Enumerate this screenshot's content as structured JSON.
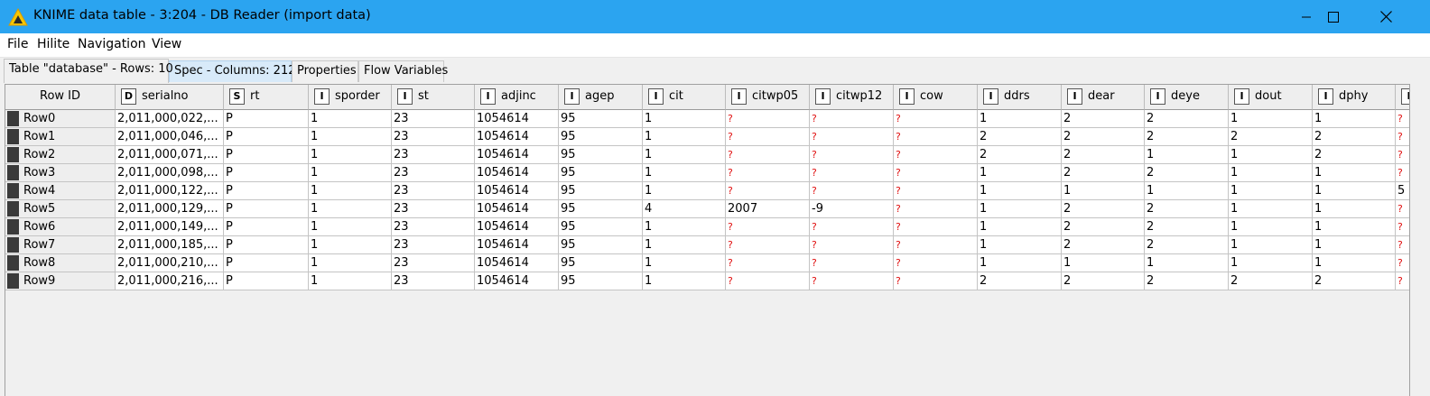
{
  "window": {
    "title": "KNIME data table - 3:204 - DB Reader (import data)",
    "accent_color": "#2ba4f0",
    "app_icon": "knime-triangle-icon",
    "controls": [
      "minimize-icon",
      "maximize-icon",
      "close-icon"
    ]
  },
  "menu": [
    "File",
    "Hilite",
    "Navigation",
    "View"
  ],
  "tabs": [
    "Table \"database\" - Rows: 10",
    "Spec - Columns: 212",
    "Properties",
    "Flow Variables"
  ],
  "table": {
    "rowid_header": "Row ID",
    "columns": [
      {
        "type": "D",
        "name": "serialno"
      },
      {
        "type": "S",
        "name": "rt"
      },
      {
        "type": "I",
        "name": "sporder"
      },
      {
        "type": "I",
        "name": "st"
      },
      {
        "type": "I",
        "name": "adjinc"
      },
      {
        "type": "I",
        "name": "agep"
      },
      {
        "type": "I",
        "name": "cit"
      },
      {
        "type": "I",
        "name": "citwp05"
      },
      {
        "type": "I",
        "name": "citwp12"
      },
      {
        "type": "I",
        "name": "cow"
      },
      {
        "type": "I",
        "name": "ddrs"
      },
      {
        "type": "I",
        "name": "dear"
      },
      {
        "type": "I",
        "name": "deye"
      },
      {
        "type": "I",
        "name": "dout"
      },
      {
        "type": "I",
        "name": "dphy"
      },
      {
        "type": "I",
        "name": ""
      }
    ],
    "missing_color": "#e01010",
    "rows": [
      {
        "id": "Row0",
        "cells": [
          "2,011,000,022,...",
          "P",
          "1",
          "23",
          "1054614",
          "95",
          "1",
          "?",
          "?",
          "?",
          "1",
          "2",
          "2",
          "1",
          "1",
          "?"
        ]
      },
      {
        "id": "Row1",
        "cells": [
          "2,011,000,046,...",
          "P",
          "1",
          "23",
          "1054614",
          "95",
          "1",
          "?",
          "?",
          "?",
          "2",
          "2",
          "2",
          "2",
          "2",
          "?"
        ]
      },
      {
        "id": "Row2",
        "cells": [
          "2,011,000,071,...",
          "P",
          "1",
          "23",
          "1054614",
          "95",
          "1",
          "?",
          "?",
          "?",
          "2",
          "2",
          "1",
          "1",
          "2",
          "?"
        ]
      },
      {
        "id": "Row3",
        "cells": [
          "2,011,000,098,...",
          "P",
          "1",
          "23",
          "1054614",
          "95",
          "1",
          "?",
          "?",
          "?",
          "1",
          "2",
          "2",
          "1",
          "1",
          "?"
        ]
      },
      {
        "id": "Row4",
        "cells": [
          "2,011,000,122,...",
          "P",
          "1",
          "23",
          "1054614",
          "95",
          "1",
          "?",
          "?",
          "?",
          "1",
          "1",
          "1",
          "1",
          "1",
          "5"
        ]
      },
      {
        "id": "Row5",
        "cells": [
          "2,011,000,129,...",
          "P",
          "1",
          "23",
          "1054614",
          "95",
          "4",
          "2007",
          "-9",
          "?",
          "1",
          "2",
          "2",
          "1",
          "1",
          "?"
        ]
      },
      {
        "id": "Row6",
        "cells": [
          "2,011,000,149,...",
          "P",
          "1",
          "23",
          "1054614",
          "95",
          "1",
          "?",
          "?",
          "?",
          "1",
          "2",
          "2",
          "1",
          "1",
          "?"
        ]
      },
      {
        "id": "Row7",
        "cells": [
          "2,011,000,185,...",
          "P",
          "1",
          "23",
          "1054614",
          "95",
          "1",
          "?",
          "?",
          "?",
          "1",
          "2",
          "2",
          "1",
          "1",
          "?"
        ]
      },
      {
        "id": "Row8",
        "cells": [
          "2,011,000,210,...",
          "P",
          "1",
          "23",
          "1054614",
          "95",
          "1",
          "?",
          "?",
          "?",
          "1",
          "1",
          "1",
          "1",
          "1",
          "?"
        ]
      },
      {
        "id": "Row9",
        "cells": [
          "2,011,000,216,...",
          "P",
          "1",
          "23",
          "1054614",
          "95",
          "1",
          "?",
          "?",
          "?",
          "2",
          "2",
          "2",
          "2",
          "2",
          "?"
        ]
      }
    ]
  }
}
